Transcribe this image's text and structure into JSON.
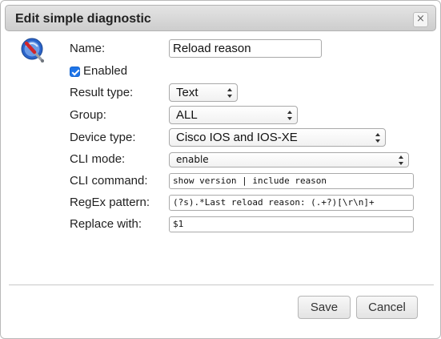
{
  "dialog": {
    "title": "Edit simple diagnostic",
    "close_label": "×"
  },
  "form": {
    "name_label": "Name:",
    "name_value": "Reload reason",
    "enabled_label": "Enabled",
    "enabled_checked": true,
    "result_type_label": "Result type:",
    "result_type_value": "Text",
    "group_label": "Group:",
    "group_value": "ALL",
    "device_type_label": "Device type:",
    "device_type_value": "Cisco IOS and IOS-XE",
    "cli_mode_label": "CLI mode:",
    "cli_mode_value": "enable",
    "cli_command_label": "CLI command:",
    "cli_command_value": "show version | include reason",
    "regex_label": "RegEx pattern:",
    "regex_value": "(?s).*Last reload reason: (.+?)[\\r\\n]+",
    "replace_label": "Replace with:",
    "replace_value": "$1"
  },
  "footer": {
    "save_label": "Save",
    "cancel_label": "Cancel"
  },
  "icons": {
    "diagnostic": "diagnostic-tool-icon",
    "close": "close-icon"
  },
  "colors": {
    "checkbox": "#1e74e8",
    "icon_blue": "#2a63c9",
    "icon_red": "#d0262b"
  }
}
